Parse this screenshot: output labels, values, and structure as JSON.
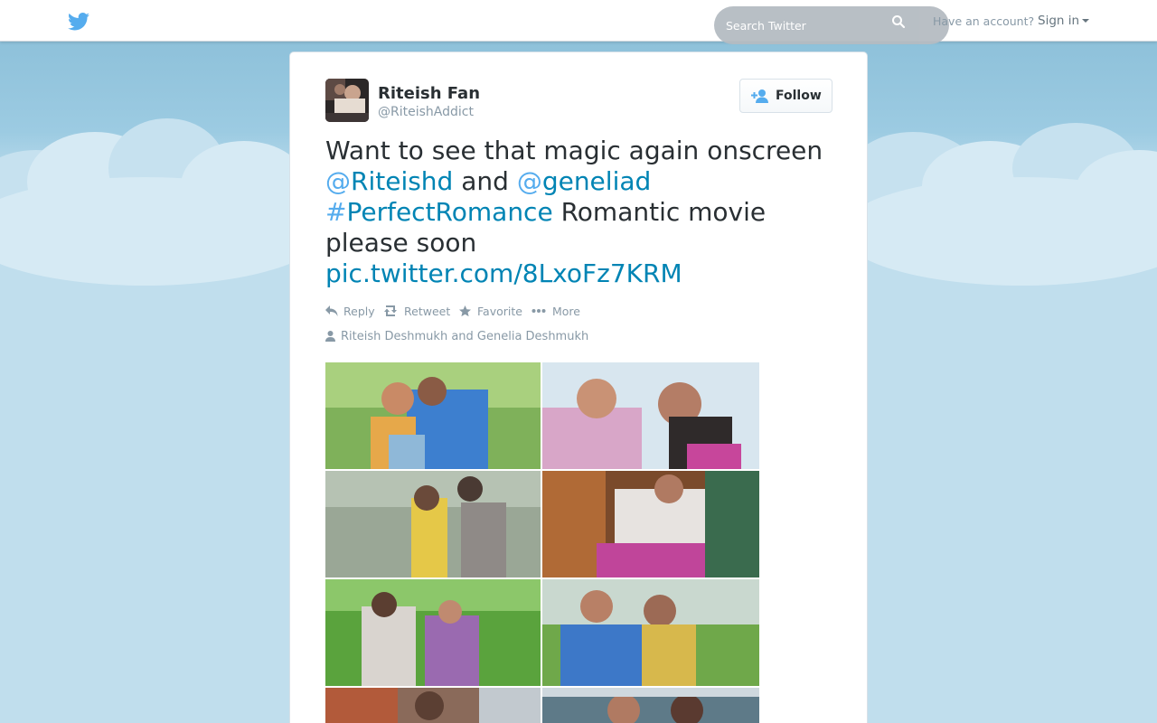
{
  "header": {
    "search_placeholder": "Search Twitter",
    "account_prompt": "Have an account?",
    "signin_label": "Sign in"
  },
  "tweet": {
    "author": {
      "full_name": "Riteish Fan",
      "username": "@RiteishAddict"
    },
    "follow_label": "Follow",
    "text": {
      "line1": "Want to see that magic again onscreen",
      "mention1": "Riteishd",
      "and_word": " and ",
      "mention2": "geneliad",
      "hashtag": "PerfectRomance",
      "rest": " Romantic movie please soon",
      "pic_link": "pic.twitter.com/8LxoFz7KRM"
    },
    "actions": {
      "reply": "Reply",
      "retweet": "Retweet",
      "favorite": "Favorite",
      "more": "More"
    },
    "tagged_people": "Riteish Deshmukh and Genelia Deshmukh"
  },
  "colors": {
    "link": "#0084b4",
    "background": "#c0deed",
    "twitter_blue": "#55acee"
  },
  "icons": [
    "twitter-bird-icon",
    "search-icon",
    "follow-person-icon",
    "reply-icon",
    "retweet-icon",
    "star-icon",
    "ellipsis-icon",
    "person-icon"
  ]
}
